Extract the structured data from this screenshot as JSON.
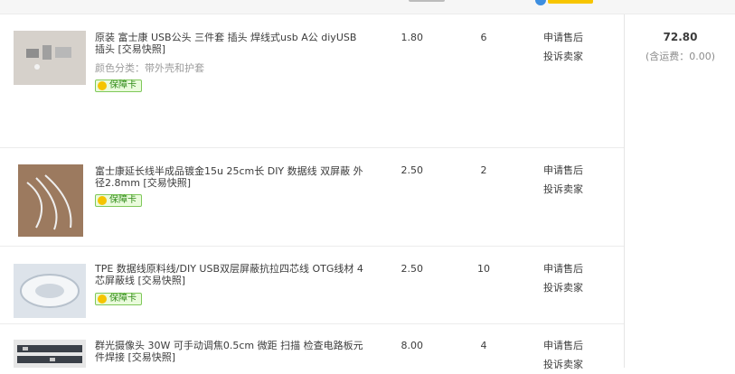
{
  "order": {
    "total": "72.80",
    "shipping": "(含运费：0.00)"
  },
  "items": [
    {
      "title": "原装 富士康 USB公头 三件套 插头 焊线式usb A公 diyUSB插头 [交易快照]",
      "sku": "颜色分类：带外壳和护套",
      "badge": "保障卡",
      "price": "1.80",
      "qty": "6",
      "action1": "申请售后",
      "action2": "投诉卖家",
      "thumb_color": "#cfcac4"
    },
    {
      "title": "富士康延长线半成品镀金15u 25cm长 DIY 数据线 双屏蔽 外径2.8mm [交易快照]",
      "sku": "",
      "badge": "保障卡",
      "price": "2.50",
      "qty": "2",
      "action1": "申请售后",
      "action2": "投诉卖家",
      "thumb_color": "#b08c70"
    },
    {
      "title": "TPE 数据线原料线/DIY USB双层屏蔽抗拉四芯线 OTG线材 4芯屏蔽线 [交易快照]",
      "sku": "",
      "badge": "保障卡",
      "price": "2.50",
      "qty": "10",
      "action1": "申请售后",
      "action2": "投诉卖家",
      "thumb_color": "#d7dde4"
    },
    {
      "title": "群光摄像头 30W 可手动调焦0.5cm 微距 扫描 检查电路板元件焊接 [交易快照]",
      "sku": "",
      "badge": "",
      "price": "8.00",
      "qty": "4",
      "action1": "申请售后",
      "action2": "投诉卖家",
      "thumb_color": "#5a5f66"
    }
  ]
}
